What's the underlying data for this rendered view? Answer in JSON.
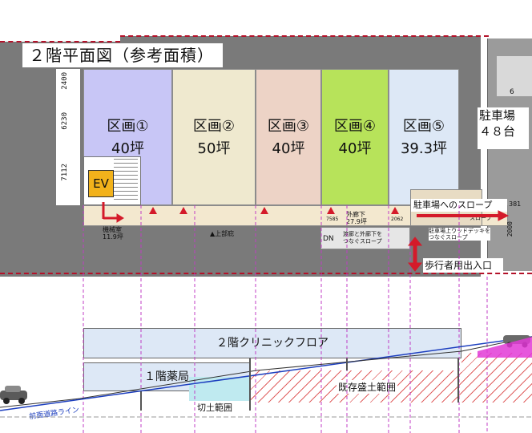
{
  "plan": {
    "title": "２階平面図（参考面積）",
    "dims": [
      "2400",
      "6230",
      "7112"
    ],
    "units": [
      {
        "name": "区画①",
        "area": "40坪",
        "color": "#c8c6f6"
      },
      {
        "name": "区画②",
        "area": "50坪",
        "color": "#efe9cf"
      },
      {
        "name": "区画③",
        "area": "40坪",
        "color": "#edd3c6"
      },
      {
        "name": "区画④",
        "area": "40坪",
        "color": "#b7e35a"
      },
      {
        "name": "区画⑤",
        "area": "39.3坪",
        "color": "#dde8f6"
      }
    ],
    "ev_label": "EV",
    "machine_room": "機械室\n11.9坪",
    "upper_corridor": "▲上部庇",
    "outer_corridor": "外廊下\n27.9坪",
    "dim_small_1": "7585",
    "dim_small_2": "2062",
    "dim_381": "381",
    "dim_2000": "2000",
    "slope_connect": "渡廊と外廊下を\nつなぐスロープ",
    "wood_deck": "駐車場上ウッドデッキを\nつなぐスロープ",
    "dn": "DN",
    "slope_to_parking": "駐車場へのスロープ",
    "slope_word": "スロープ",
    "parking": "駐車場\n４８台",
    "parking_num": "6",
    "pedestrian": "歩行者用出入口"
  },
  "section": {
    "floor2": "２階クリニックフロア",
    "floor1": "１階薬局",
    "cut_soil": "切土範囲",
    "fill_soil": "既存盛土範囲",
    "road_line": "前面道路ライン"
  },
  "colors": {
    "red": "#d41a2a",
    "magenta": "#c03dc4",
    "ev": "#f2b21b"
  }
}
